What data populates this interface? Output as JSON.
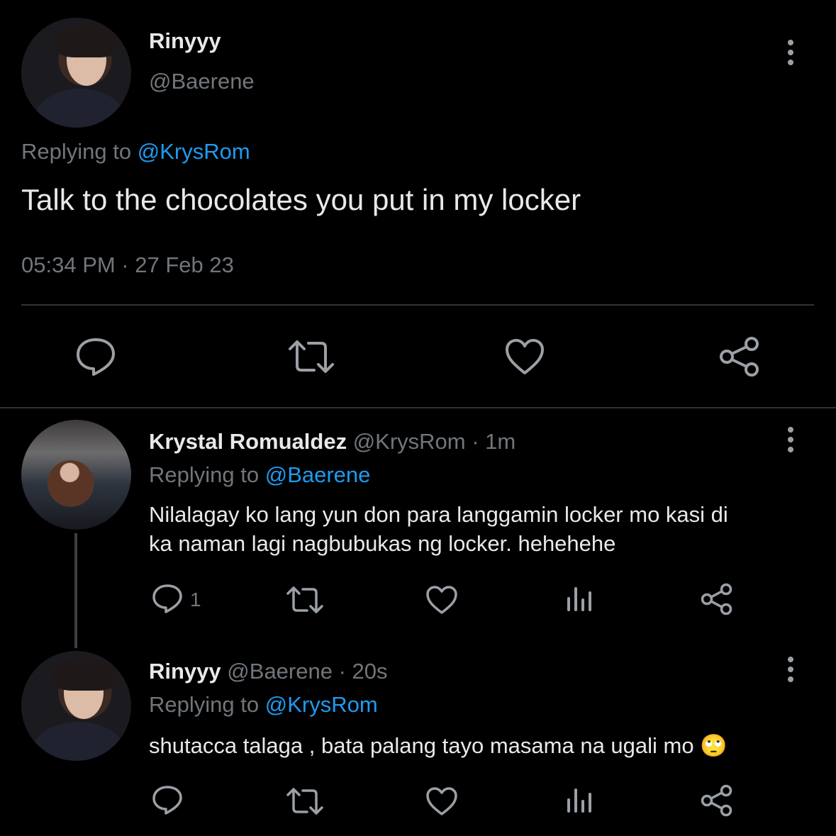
{
  "main_tweet": {
    "display_name": "Rinyyy",
    "handle": "@Baerene",
    "replying_prefix": "Replying to",
    "replying_handle": "@KrysRom",
    "text": "Talk to the chocolates you put in my locker",
    "timestamp": "05:34 PM · 27 Feb 23"
  },
  "replies": [
    {
      "display_name": "Krystal Romualdez",
      "meta": "@KrysRom · 1m",
      "replying_prefix": "Replying to",
      "replying_handle": "@Baerene",
      "text_line1": "Nilalagay ko lang yun don para langgamin locker mo kasi di",
      "text_line2": "ka naman lagi nagbubukas ng locker. hehehehe",
      "reply_count": "1"
    },
    {
      "display_name": "Rinyyy",
      "meta": "@Baerene · 20s",
      "replying_prefix": "Replying to",
      "replying_handle": "@KrysRom",
      "text": "shutacca talaga , bata palang tayo masama na ugali mo 🙄"
    }
  ],
  "colors": {
    "background": "#000000",
    "text": "#e7e9ea",
    "muted": "#71767b",
    "link": "#1d9bf0",
    "divider": "#2f3336"
  },
  "icons": [
    "reply-icon",
    "retweet-icon",
    "like-icon",
    "share-icon",
    "analytics-icon",
    "more-options-icon"
  ]
}
